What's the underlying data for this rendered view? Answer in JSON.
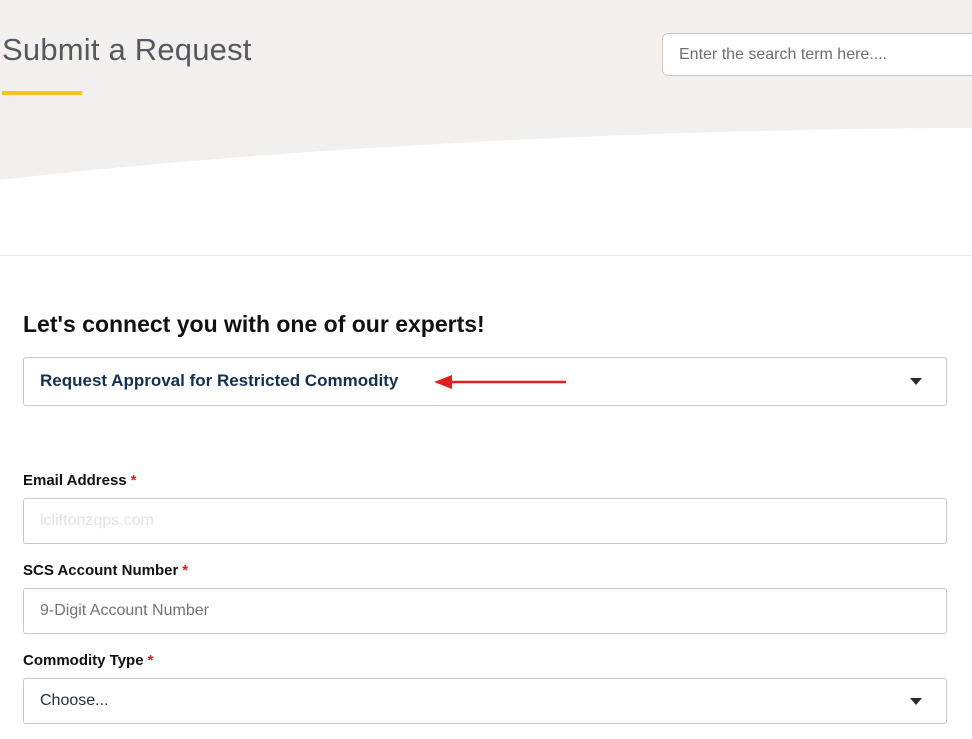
{
  "header": {
    "title": "Submit a Request",
    "search": {
      "placeholder": "Enter the search term here....",
      "value": ""
    },
    "accent_color": "#f5c518"
  },
  "form": {
    "heading": "Let's connect you with one of our experts!",
    "request_type": {
      "selected": "Request Approval for Restricted Commodity"
    },
    "required_marker": "*",
    "fields": {
      "email": {
        "label": "Email Address",
        "placeholder": "lcliftonzqps.com",
        "value": ""
      },
      "account_number": {
        "label": "SCS Account Number",
        "placeholder": "9-Digit Account Number",
        "value": ""
      },
      "commodity_type": {
        "label": "Commodity Type",
        "selected": "Choose..."
      }
    }
  },
  "annotation": {
    "arrow_color": "#e02020"
  }
}
